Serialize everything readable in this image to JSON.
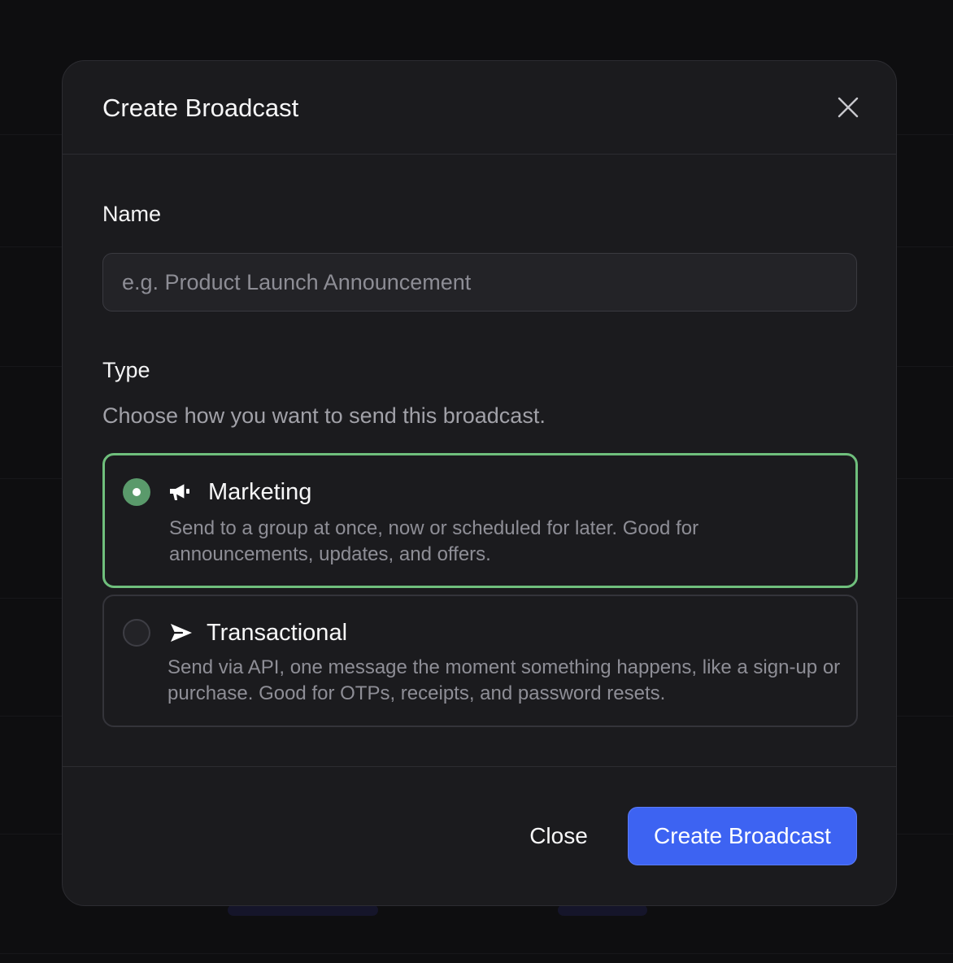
{
  "modal": {
    "title": "Create Broadcast",
    "close_icon": "close-icon"
  },
  "form": {
    "name_label": "Name",
    "name_placeholder": "e.g. Product Launch Announcement",
    "name_value": "",
    "type_label": "Type",
    "type_hint": "Choose how you want to send this broadcast."
  },
  "options": [
    {
      "title": "Marketing",
      "description": "Send to a group at once, now or scheduled for later. Good for announcements, updates, and offers.",
      "icon": "megaphone-icon",
      "selected": true
    },
    {
      "title": "Transactional",
      "description": "Send via API, one message the moment something happens, like a sign-up or purchase. Good for OTPs, receipts, and password resets.",
      "icon": "send-icon",
      "selected": false
    }
  ],
  "footer": {
    "close_label": "Close",
    "create_label": "Create Broadcast"
  },
  "colors": {
    "accent": "#3d63f2",
    "selected_border": "#6fbf7c",
    "radio_on": "#5a9a6b",
    "modal_bg": "#1b1b1e"
  }
}
